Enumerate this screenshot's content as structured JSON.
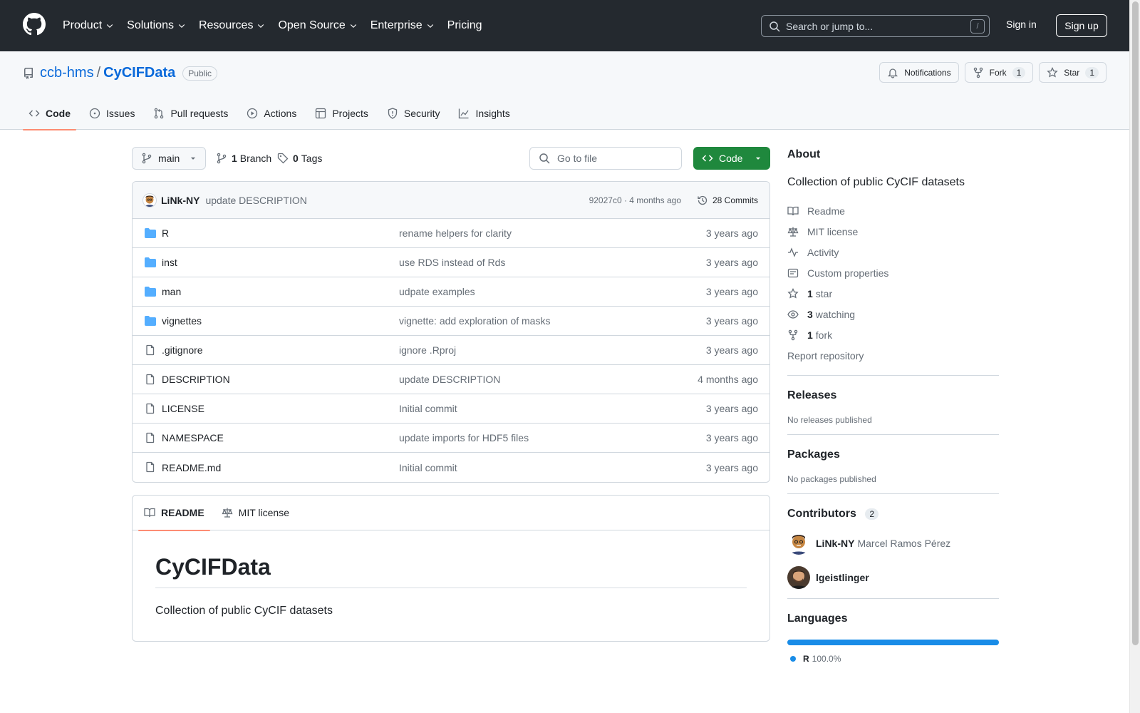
{
  "header": {
    "nav": [
      {
        "label": "Product",
        "dropdown": true
      },
      {
        "label": "Solutions",
        "dropdown": true
      },
      {
        "label": "Resources",
        "dropdown": true
      },
      {
        "label": "Open Source",
        "dropdown": true
      },
      {
        "label": "Enterprise",
        "dropdown": true
      },
      {
        "label": "Pricing",
        "dropdown": false
      }
    ],
    "search_placeholder": "Search or jump to...",
    "search_key": "/",
    "sign_in": "Sign in",
    "sign_up": "Sign up"
  },
  "repo": {
    "owner": "ccb-hms",
    "separator": "/",
    "name": "CyCIFData",
    "visibility": "Public",
    "notifications_label": "Notifications",
    "fork_label": "Fork",
    "fork_count": "1",
    "star_label": "Star",
    "star_count": "1"
  },
  "tabs": [
    {
      "label": "Code",
      "icon": "code-icon",
      "active": true
    },
    {
      "label": "Issues",
      "icon": "issue-icon",
      "active": false
    },
    {
      "label": "Pull requests",
      "icon": "pull-request-icon",
      "active": false
    },
    {
      "label": "Actions",
      "icon": "play-icon",
      "active": false
    },
    {
      "label": "Projects",
      "icon": "table-icon",
      "active": false
    },
    {
      "label": "Security",
      "icon": "shield-icon",
      "active": false
    },
    {
      "label": "Insights",
      "icon": "graph-icon",
      "active": false
    }
  ],
  "toolbar": {
    "branch": "main",
    "branch_count": "1",
    "branch_label": "Branch",
    "tag_count": "0",
    "tag_label": "Tags",
    "goto_placeholder": "Go to file",
    "code_button": "Code"
  },
  "latest_commit": {
    "author": "LiNk-NY",
    "message": "update DESCRIPTION",
    "meta": "92027c0 · 4 months ago",
    "commits_label": "28 Commits"
  },
  "files": [
    {
      "name": "R",
      "type": "dir",
      "message": "rename helpers for clarity",
      "age": "3 years ago"
    },
    {
      "name": "inst",
      "type": "dir",
      "message": "use RDS instead of Rds",
      "age": "3 years ago"
    },
    {
      "name": "man",
      "type": "dir",
      "message": "udpate examples",
      "age": "3 years ago"
    },
    {
      "name": "vignettes",
      "type": "dir",
      "message": "vignette: add exploration of masks",
      "age": "3 years ago"
    },
    {
      "name": ".gitignore",
      "type": "file",
      "message": "ignore .Rproj",
      "age": "3 years ago"
    },
    {
      "name": "DESCRIPTION",
      "type": "file",
      "message": "update DESCRIPTION",
      "age": "4 months ago"
    },
    {
      "name": "LICENSE",
      "type": "file",
      "message": "Initial commit",
      "age": "3 years ago"
    },
    {
      "name": "NAMESPACE",
      "type": "file",
      "message": "update imports for HDF5 files",
      "age": "3 years ago"
    },
    {
      "name": "README.md",
      "type": "file",
      "message": "Initial commit",
      "age": "3 years ago"
    }
  ],
  "readme": {
    "tab_readme": "README",
    "tab_license": "MIT license",
    "heading": "CyCIFData",
    "body": "Collection of public CyCIF datasets"
  },
  "sidebar": {
    "about_title": "About",
    "description": "Collection of public CyCIF datasets",
    "links": [
      {
        "icon": "book-icon",
        "bold": "",
        "label": "Readme"
      },
      {
        "icon": "law-icon",
        "bold": "",
        "label": "MIT license"
      },
      {
        "icon": "pulse-icon",
        "bold": "",
        "label": "Activity"
      },
      {
        "icon": "note-icon",
        "bold": "",
        "label": "Custom properties"
      },
      {
        "icon": "star-icon",
        "bold": "1",
        "label": "star"
      },
      {
        "icon": "eye-icon",
        "bold": "3",
        "label": "watching"
      },
      {
        "icon": "fork-icon",
        "bold": "1",
        "label": "fork"
      }
    ],
    "report": "Report repository",
    "releases_title": "Releases",
    "releases_empty": "No releases published",
    "packages_title": "Packages",
    "packages_empty": "No packages published",
    "contributors_title": "Contributors",
    "contributors_count": "2",
    "contributors": [
      {
        "login": "LiNk-NY",
        "name": "Marcel Ramos Pérez"
      },
      {
        "login": "lgeistlinger",
        "name": ""
      }
    ],
    "languages_title": "Languages",
    "languages": [
      {
        "name": "R",
        "percent": "100.0%",
        "color": "#198ce7"
      }
    ]
  },
  "colors": {
    "header_bg": "#24292f",
    "link": "#0969da",
    "primary_button": "#1f883d",
    "active_tab_underline": "#fd8c73",
    "folder": "#54aeff"
  }
}
